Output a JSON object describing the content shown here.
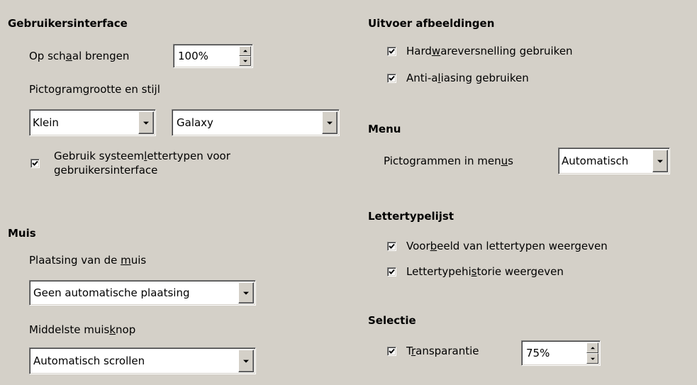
{
  "ui": {
    "heading": "Gebruikersinterface",
    "scale_label_pre": "Op sch",
    "scale_label_mn": "a",
    "scale_label_post": "al brengen",
    "scale_value": "100%",
    "icon_label_pre": "Pictogram",
    "icon_label_mn": "g",
    "icon_label_post": "rootte en stijl",
    "icon_size_value": "Klein",
    "icon_style_value": "Galaxy",
    "sysfont_line1_pre": "Gebruik systeem",
    "sysfont_line1_mn": "l",
    "sysfont_line1_post": "ettertypen voor",
    "sysfont_line2": "gebruikersinterface",
    "sysfont_checked": true
  },
  "mouse": {
    "heading": "Muis",
    "placement_label_pre": "Plaatsing van de ",
    "placement_label_mn": "m",
    "placement_label_post": "uis",
    "placement_value": "Geen automatische plaatsing",
    "middle_label_pre": "Middelste muis",
    "middle_label_mn": "k",
    "middle_label_post": "nop",
    "middle_value": "Automatisch scrollen"
  },
  "output": {
    "heading": "Uitvoer afbeeldingen",
    "hw_pre": "Hard",
    "hw_mn": "w",
    "hw_post": "areversnelling gebruiken",
    "hw_checked": true,
    "aa_pre": "Anti-a",
    "aa_mn": "l",
    "aa_post": "iasing gebruiken",
    "aa_checked": true
  },
  "menu": {
    "heading": "Menu",
    "icons_label_pre": "Pictogrammen in men",
    "icons_label_mn": "u",
    "icons_label_post": "s",
    "icons_value": "Automatisch"
  },
  "fontlist": {
    "heading": "Lettertypelijst",
    "preview_pre": "Voor",
    "preview_mn": "b",
    "preview_post": "eeld van lettertypen weergeven",
    "preview_checked": true,
    "history_pre": "Lettertypehi",
    "history_mn": "s",
    "history_post": "torie weergeven",
    "history_checked": true
  },
  "selection": {
    "heading": "Selectie",
    "transp_pre": "T",
    "transp_mn": "r",
    "transp_post": "ansparantie",
    "transp_checked": true,
    "transp_value": "75%"
  }
}
